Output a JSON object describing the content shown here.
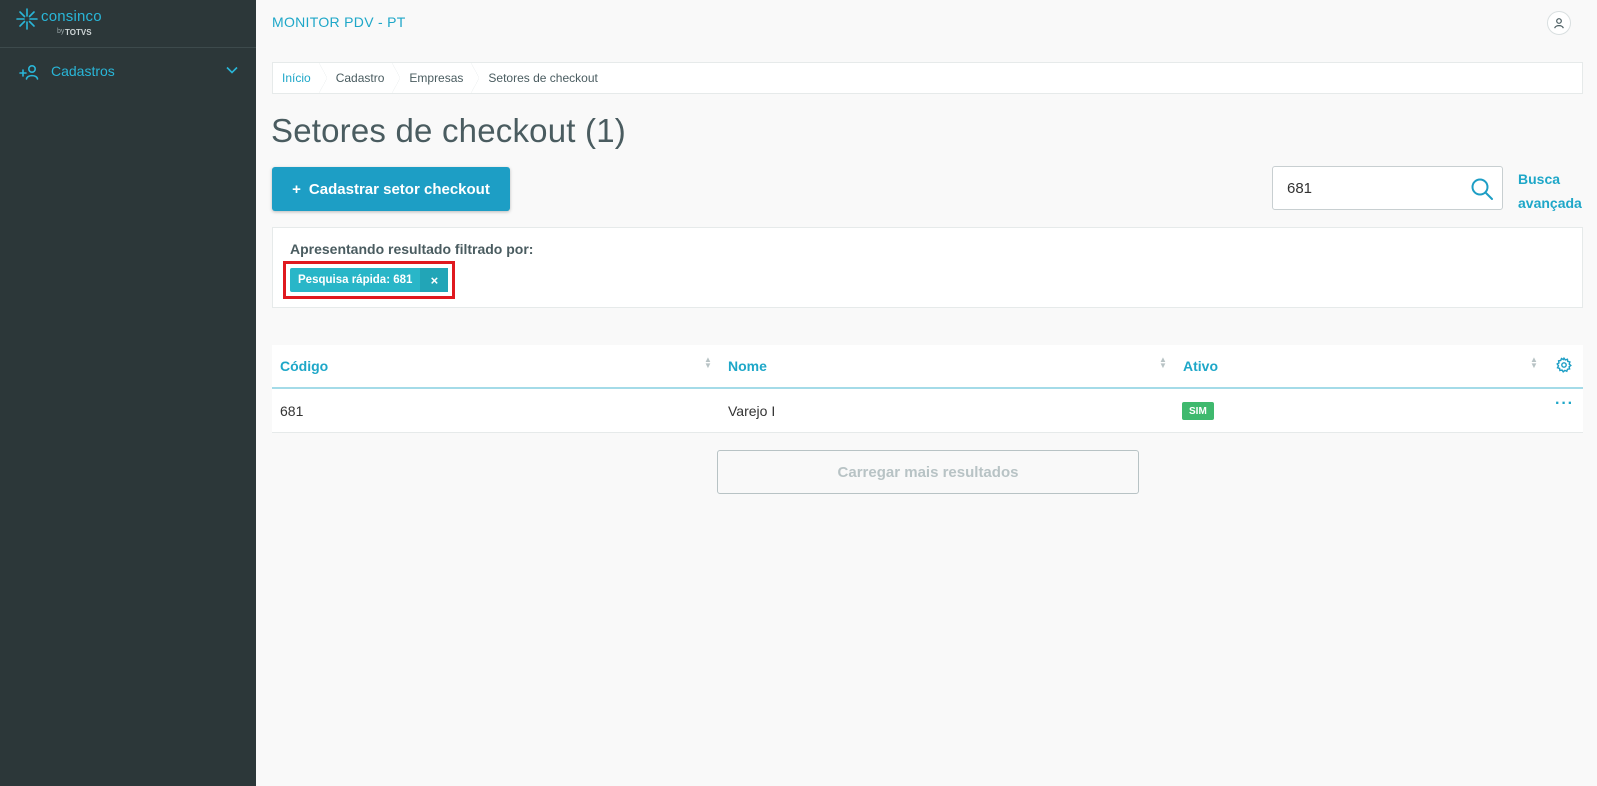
{
  "sidebar": {
    "logo_text": "consinco",
    "logo_by": "by",
    "logo_brand": "TOTVS",
    "menu": [
      {
        "label": "Cadastros",
        "icon": "add-user-icon",
        "expand_icon": "chevron-down-icon"
      }
    ]
  },
  "header": {
    "app_title": "MONITOR PDV - PT",
    "user_icon": "user-icon"
  },
  "breadcrumb": [
    "Início",
    "Cadastro",
    "Empresas",
    "Setores de checkout"
  ],
  "page": {
    "title": "Setores de checkout (1)",
    "primary_button": {
      "icon": "+",
      "label": "Cadastrar setor checkout"
    }
  },
  "search": {
    "value": "681",
    "placeholder": "",
    "icon": "search-icon",
    "advanced_line1": "Busca",
    "advanced_line2": "avançada"
  },
  "filter": {
    "title": "Apresentando resultado filtrado por:",
    "tags": [
      {
        "label": "Pesquisa rápida: 681",
        "close": "×"
      }
    ]
  },
  "table": {
    "columns": [
      "Código",
      "Nome",
      "Ativo"
    ],
    "settings_icon": "gear-icon",
    "rows": [
      {
        "codigo": "681",
        "nome": "Varejo I",
        "ativo": "SIM",
        "actions": "···"
      }
    ]
  },
  "load_more_label": "Carregar mais resultados",
  "colors": {
    "sidebar_bg": "#2c3739",
    "accent": "#1d9ec5",
    "tag_bg": "#29b6c8",
    "highlight": "#e0191f",
    "badge_active": "#3fb96e"
  }
}
